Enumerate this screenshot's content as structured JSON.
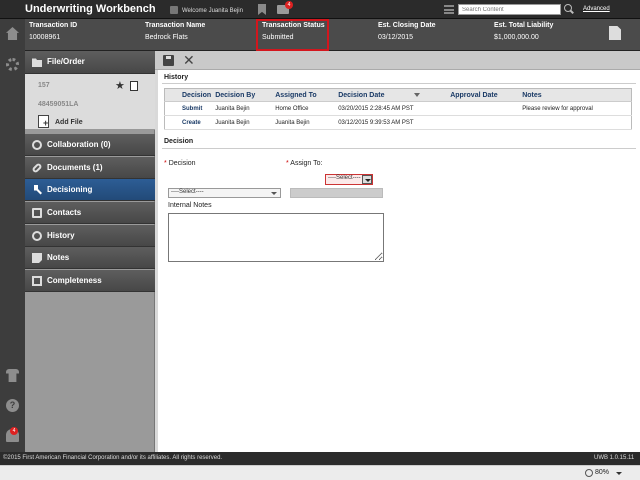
{
  "app": {
    "title": "Underwriting Workbench"
  },
  "topbar": {
    "welcome": "Welcome Juanita Bejin",
    "mail_badge": "4",
    "search_placeholder": "Search Content",
    "advanced_label": "Advanced"
  },
  "rail": {
    "notification_badge": "4"
  },
  "transaction": {
    "columns": [
      {
        "label": "Transaction ID",
        "value": "10008961"
      },
      {
        "label": "Transaction Name",
        "value": "Bedrock Flats"
      },
      {
        "label": "Transaction Status",
        "value": "Submitted"
      },
      {
        "label": "Est. Closing Date",
        "value": "03/12/2015"
      },
      {
        "label": "Est. Total Liability",
        "value": "$1,000,000.00"
      }
    ]
  },
  "nav": {
    "file_order": "File/Order",
    "file_number_1": "157",
    "file_number_2": "48459051LA",
    "add_file": "Add File",
    "items": [
      {
        "label": "Collaboration (0)"
      },
      {
        "label": "Documents (1)"
      },
      {
        "label": "Decisioning"
      },
      {
        "label": "Contacts"
      },
      {
        "label": "History"
      },
      {
        "label": "Notes"
      },
      {
        "label": "Completeness"
      }
    ],
    "active": "Decisioning"
  },
  "history": {
    "title": "History",
    "columns": [
      "Decision",
      "Decision By",
      "Assigned To",
      "Decision Date",
      "Approval Date",
      "Notes"
    ],
    "rows": [
      [
        "Submit",
        "Juanita Bejin",
        "Home Office",
        "03/20/2015 2:28:45 AM PST",
        "",
        "Please review for approval"
      ],
      [
        "Create",
        "Juanita Bejin",
        "Juanita Bejin",
        "03/12/2015 9:39:53 AM PST",
        "",
        ""
      ]
    ]
  },
  "decision": {
    "title": "Decision",
    "required_mark": "*",
    "decision_label": "Decision",
    "decision_value": "----Select----",
    "assign_label": "Assign To:",
    "assign_value": "----Select----",
    "internal_notes_label": "Internal Notes"
  },
  "footer": {
    "copyright": "©2015 First American Financial Corporation and/or its affiliates. All rights reserved.",
    "version": "UWB 1.0.15.11"
  },
  "statusbar": {
    "zoom": "80%"
  },
  "colors": {
    "highlight": "#d3161d",
    "active_nav": "#2d5d95",
    "header_bg": "#4b4b4b"
  }
}
